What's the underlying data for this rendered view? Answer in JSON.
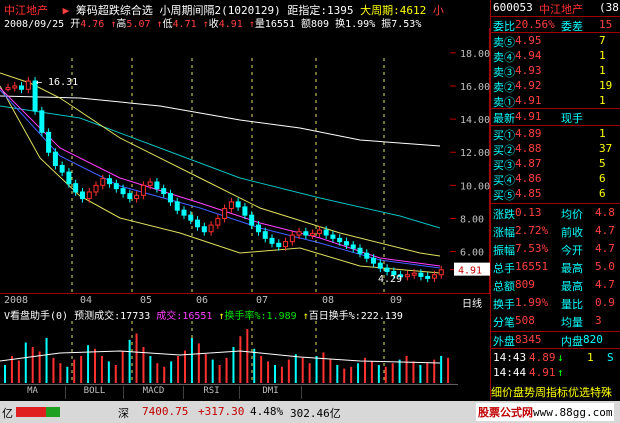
{
  "header": {
    "stock_name": "中江地产",
    "marker": "▶",
    "indicator": "筹码超跌综合选",
    "period": "小周期间隔2(1020129)",
    "dist_label": "距指定:",
    "dist_value": "1395",
    "big_period_label": "大周期:",
    "big_period_value": "4612",
    "small_label": "小"
  },
  "ohlc": {
    "date": "2008/09/25",
    "open_label": "开",
    "open": "4.76",
    "high_label": "高",
    "high": "5.07",
    "low_label": "低",
    "low": "4.71",
    "close_label": "收",
    "close": "4.91",
    "vol_label": "量",
    "vol": "16551",
    "amt_label": "额",
    "amt": "809",
    "turn_label": "换",
    "turn": "1.99%",
    "amp_label": "振",
    "amp": "7.53%"
  },
  "price_axis": [
    "18.00",
    "16.00",
    "14.00",
    "12.00",
    "10.00",
    "8.00",
    "6.00",
    "4.91"
  ],
  "annotations": {
    "high_mark": "16.31",
    "low_mark": "4.29"
  },
  "time_axis": {
    "months": [
      "2008",
      "04",
      "05",
      "06",
      "07",
      "08",
      "09"
    ],
    "period_label": "日线"
  },
  "volume_header": {
    "title": "V看盘助手(0)",
    "predict_label": "预测成交:",
    "predict_value": "17733",
    "vol_label": "成交:",
    "vol_value": "16551",
    "turn_label": "换手率%:",
    "turn_value": "1.989",
    "turn100_label": "百日换手%:",
    "turn100_value": "222.139"
  },
  "tabs": [
    "MA",
    "BOLL",
    "MACD",
    "RSI",
    "DMI"
  ],
  "status_bar": {
    "left_unit": "亿",
    "index_name": "深",
    "index_value": "7400.75",
    "index_change": "+317.30",
    "index_pct": "4.48%",
    "index_amount": "302.46亿",
    "watermark": "股票公式网",
    "watermark_url": "www.88gg.com"
  },
  "quote": {
    "code": "600053",
    "name": "中江地产",
    "suffix": "(38",
    "weibi_label": "委比",
    "weibi": "20.56%",
    "weicha_label": "委差",
    "weicha": "15",
    "sells": [
      {
        "label": "卖⑤",
        "price": "4.95",
        "vol": "7"
      },
      {
        "label": "卖④",
        "price": "4.94",
        "vol": "1"
      },
      {
        "label": "卖③",
        "price": "4.93",
        "vol": "1"
      },
      {
        "label": "卖②",
        "price": "4.92",
        "vol": "19"
      },
      {
        "label": "卖①",
        "price": "4.91",
        "vol": "1"
      }
    ],
    "last_label": "最新",
    "last": "4.91",
    "xianshou_label": "现手",
    "buys": [
      {
        "label": "买①",
        "price": "4.89",
        "vol": "1"
      },
      {
        "label": "买②",
        "price": "4.88",
        "vol": "37"
      },
      {
        "label": "买③",
        "price": "4.87",
        "vol": "5"
      },
      {
        "label": "买④",
        "price": "4.86",
        "vol": "6"
      },
      {
        "label": "买⑤",
        "price": "4.85",
        "vol": "6"
      }
    ],
    "stats": [
      {
        "l1": "涨跌",
        "v1": "0.13",
        "l2": "均价",
        "v2": "4.8"
      },
      {
        "l1": "涨幅",
        "v1": "2.72%",
        "l2": "前收",
        "v2": "4.7"
      },
      {
        "l1": "振幅",
        "v1": "7.53%",
        "l2": "今开",
        "v2": "4.7"
      },
      {
        "l1": "总手",
        "v1": "16551",
        "l2": "最高",
        "v2": "5.0"
      },
      {
        "l1": "总额",
        "v1": "809",
        "l2": "最高",
        "v2": "4.7"
      },
      {
        "l1": "换手",
        "v1": "1.99%",
        "l2": "量比",
        "v2": "0.9"
      },
      {
        "l1": "分笔",
        "v1": "508",
        "l2": "均量",
        "v2": "3"
      }
    ],
    "outer_label": "外盘",
    "outer": "8345",
    "inner_label": "内盘",
    "inner": "820",
    "ticks": [
      {
        "time": "14:43",
        "price": "4.89",
        "dir": "↓",
        "vol": "1",
        "side": "S"
      },
      {
        "time": "14:44",
        "price": "4.91",
        "dir": "↑",
        "vol": "",
        "side": ""
      }
    ],
    "scroll_text": "细价盘势周指标优选特殊"
  },
  "colors": {
    "up": "#ff3030",
    "down": "#00ffff",
    "accent": "#ffff00",
    "border": "#a00000"
  }
}
